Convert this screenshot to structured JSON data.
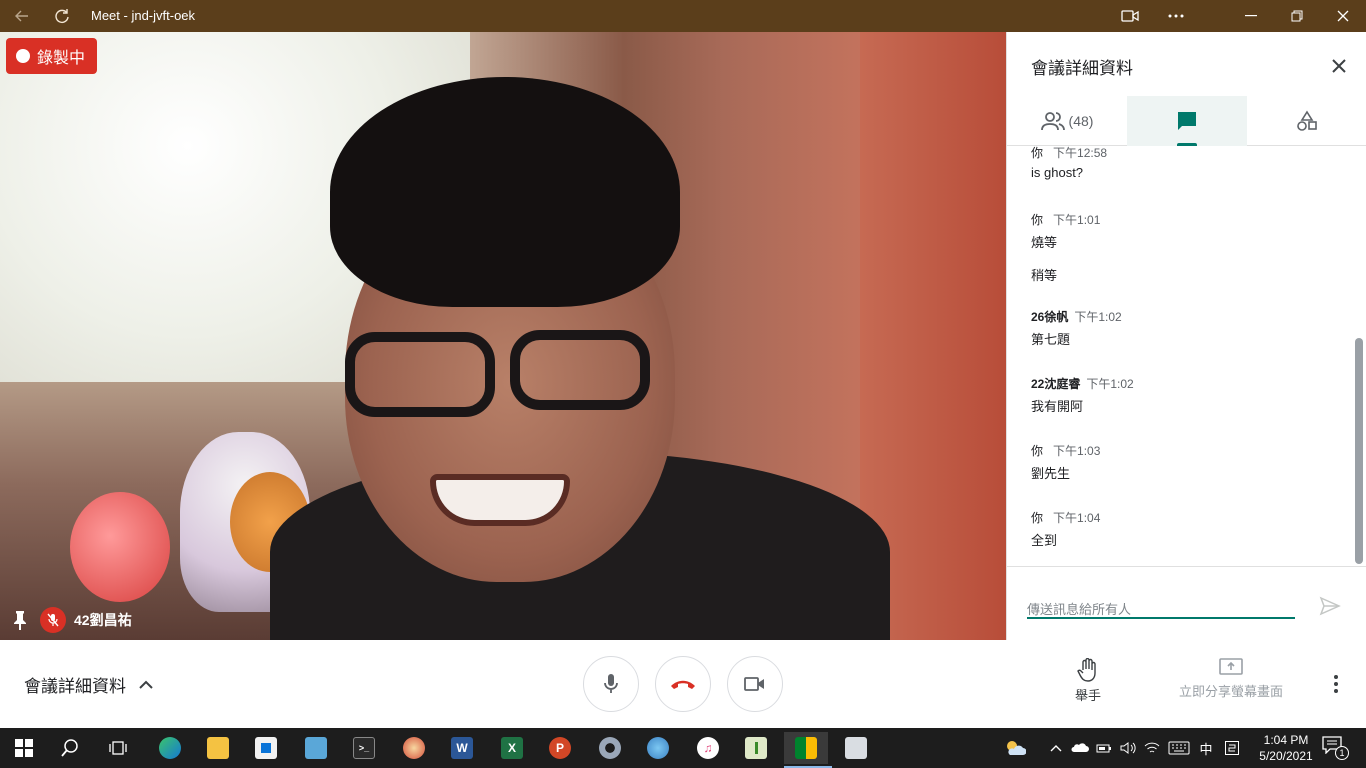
{
  "window": {
    "title": "Meet - jnd-jvft-oek"
  },
  "video": {
    "recording_label": "錄製中",
    "participant_name": "42劉昌祐"
  },
  "panel": {
    "title": "會議詳細資料",
    "people_count": "(48)",
    "messages": [
      {
        "sender": "你",
        "time": "下午12:58",
        "lines": [
          "is ghost?"
        ]
      },
      {
        "sender": "你",
        "time": "下午1:01",
        "lines": [
          "燒等",
          "稍等"
        ]
      },
      {
        "sender": "26徐帆",
        "time": "下午1:02",
        "lines": [
          "第七題"
        ]
      },
      {
        "sender": "22沈庭睿",
        "time": "下午1:02",
        "lines": [
          "我有開阿"
        ]
      },
      {
        "sender": "你",
        "time": "下午1:03",
        "lines": [
          "劉先生"
        ]
      },
      {
        "sender": "你",
        "time": "下午1:04",
        "lines": [
          "全到"
        ]
      }
    ],
    "compose_placeholder": "傳送訊息給所有人"
  },
  "bottombar": {
    "details_label": "會議詳細資料",
    "raise_hand_label": "舉手",
    "present_label": "立即分享螢幕畫面"
  },
  "taskbar": {
    "input_method": "中",
    "time": "1:04 PM",
    "date": "5/20/2021",
    "notification_count": "1"
  },
  "colors": {
    "titlebar": "#5b3e1b",
    "recording": "#d93025",
    "accent": "#00796b",
    "hangup": "#d93025"
  }
}
